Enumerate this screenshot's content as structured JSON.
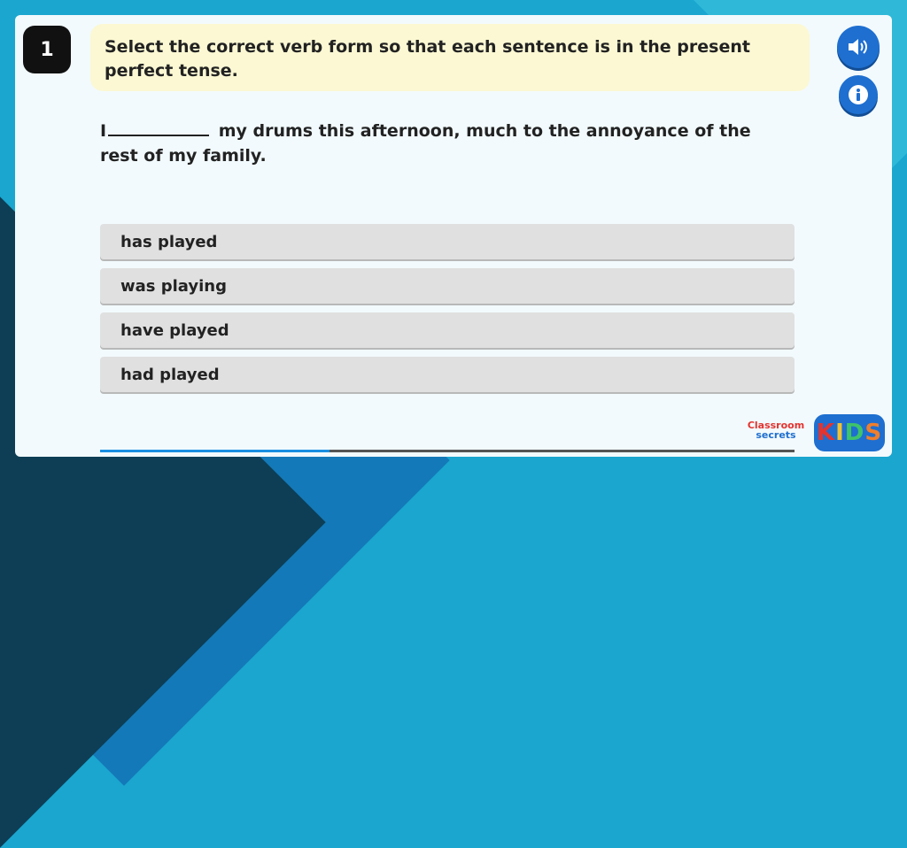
{
  "question": {
    "number": "1",
    "instruction": "Select the correct verb form so that each sentence is in the present perfect tense.",
    "sentence_start": "I",
    "sentence_rest": "my drums this afternoon, much to the annoyance of the rest of my family."
  },
  "options": [
    "has played",
    "was playing",
    "have played",
    "had played"
  ],
  "progress": {
    "fraction": 0.33
  },
  "icons": {
    "audio": "speaker-icon",
    "info": "info-icon"
  },
  "logo": {
    "classroom": "Classroom",
    "secrets": "secrets",
    "kids": [
      "K",
      "I",
      "D",
      "S"
    ]
  },
  "colors": {
    "accent_blue": "#1e6fd0",
    "instruction_bg": "#fbf8d3",
    "option_bg": "#e0e0e0"
  }
}
